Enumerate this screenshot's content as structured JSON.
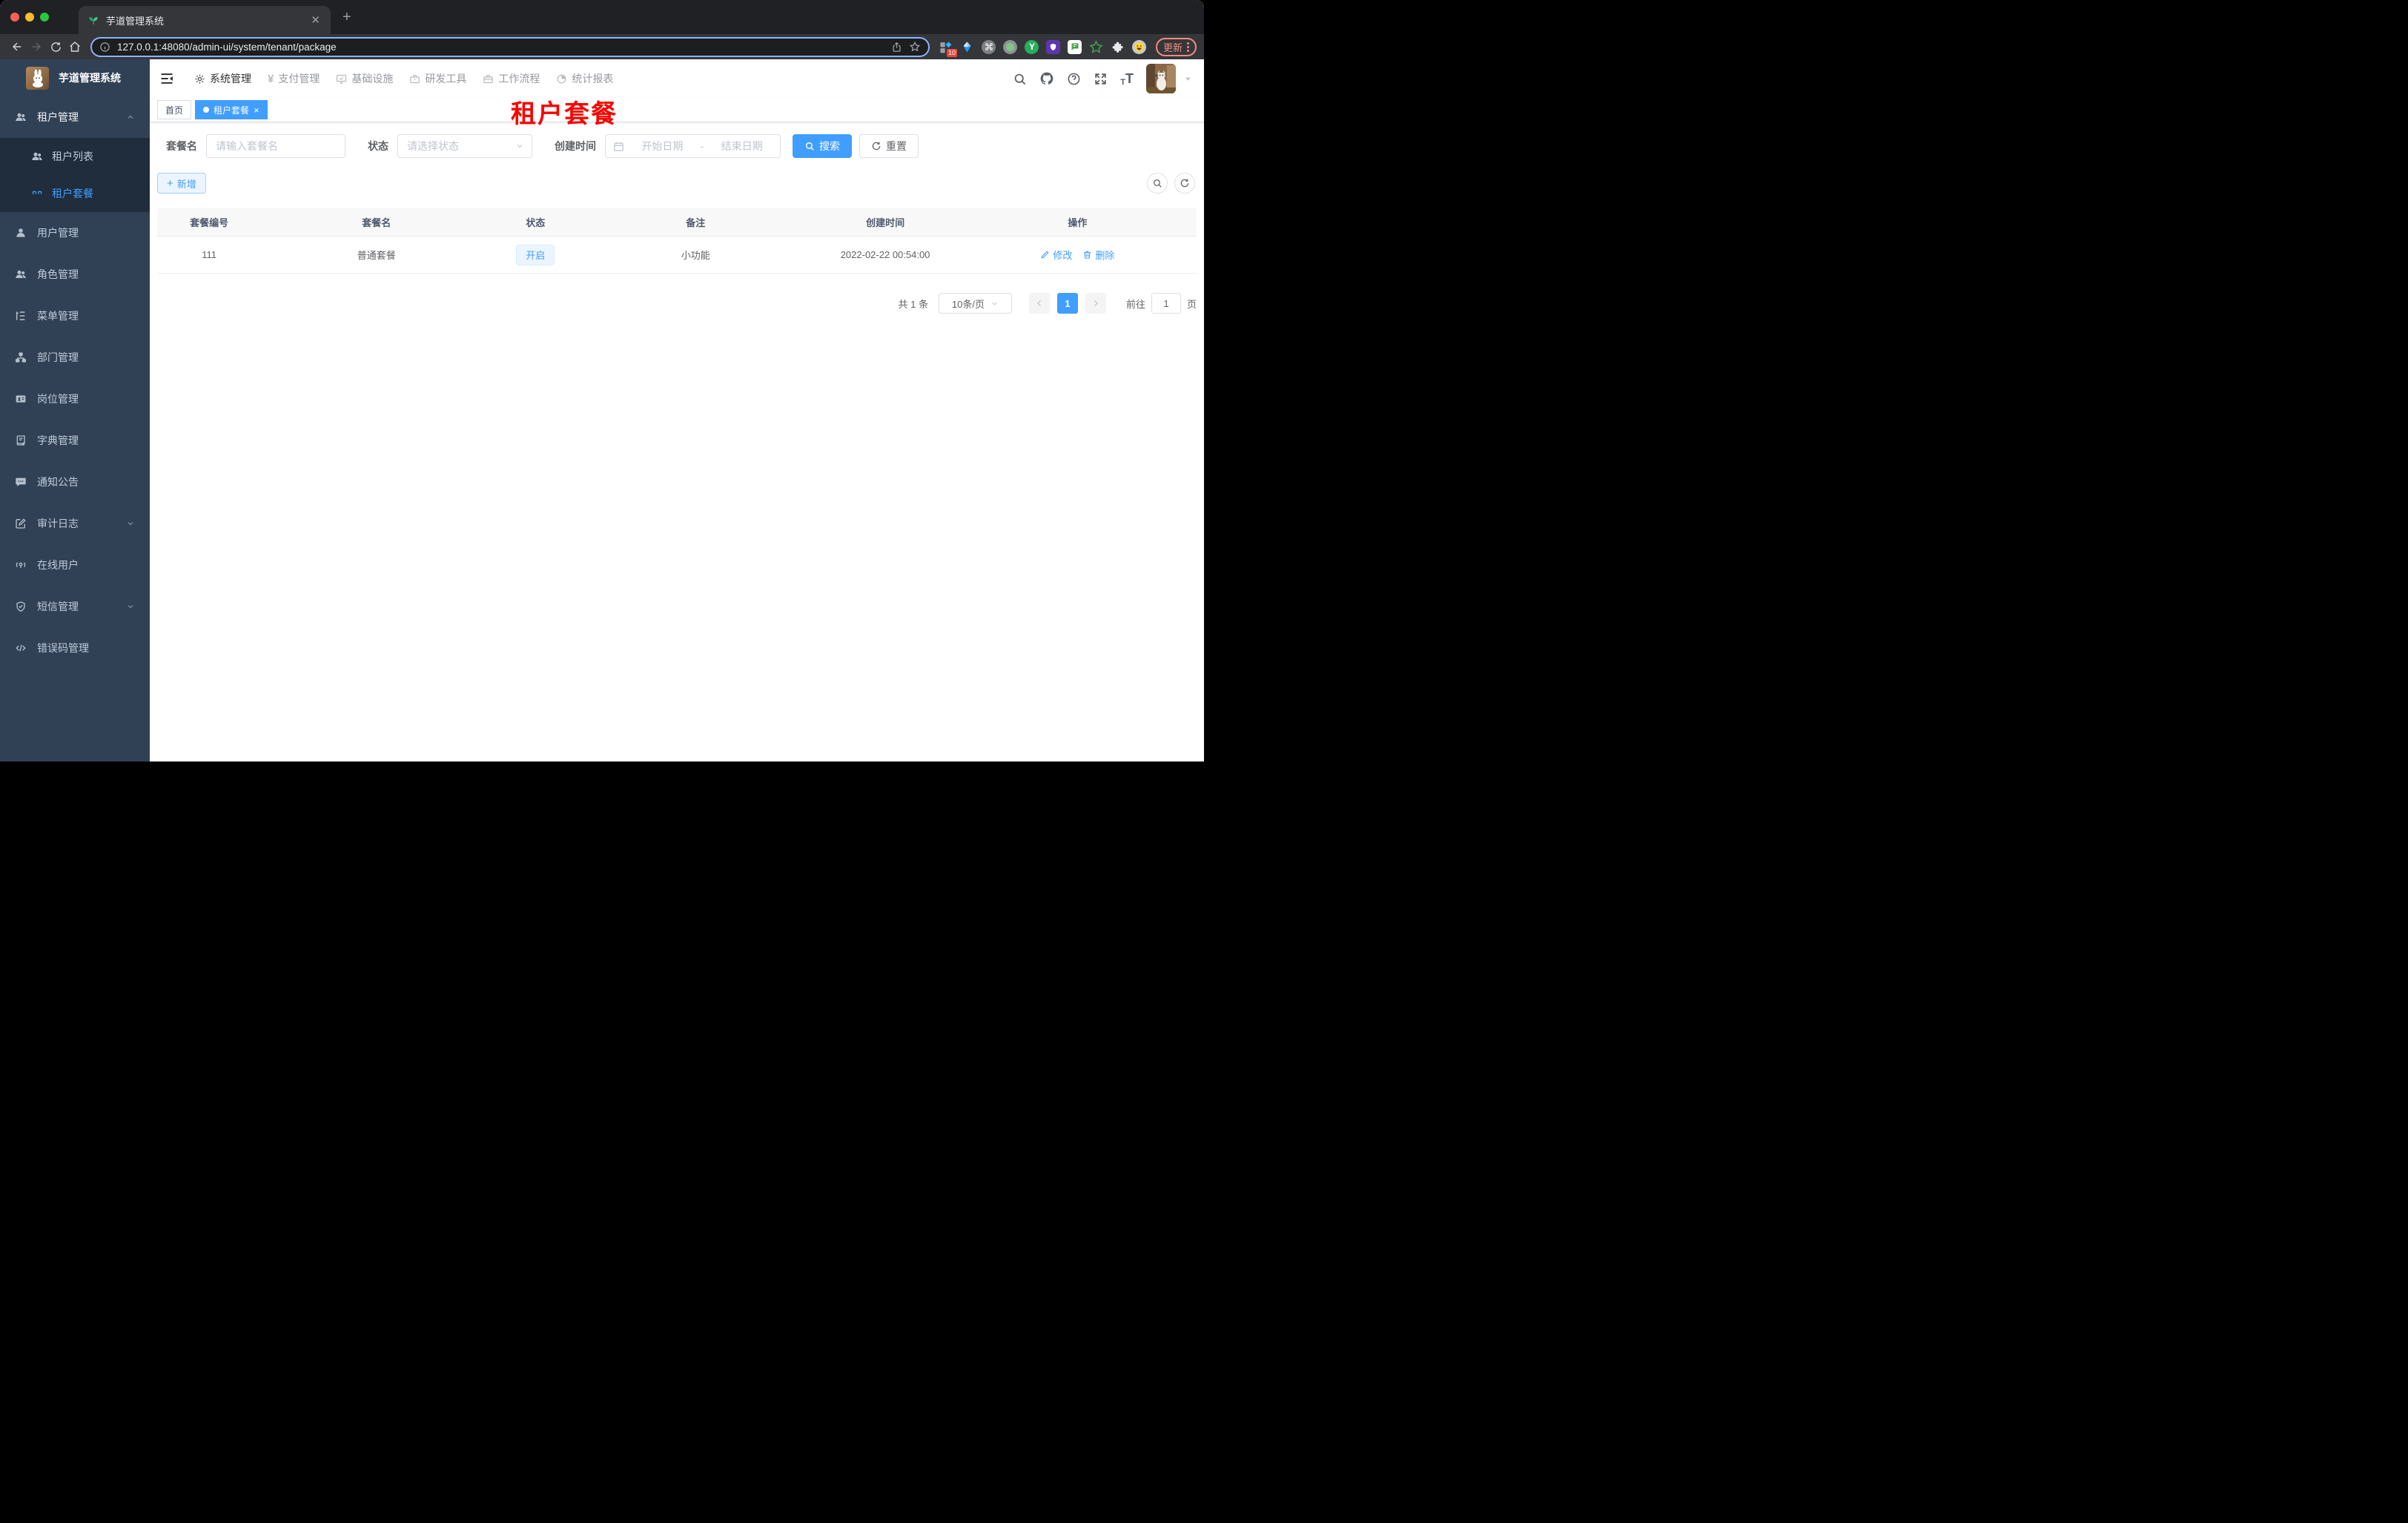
{
  "colors": {
    "accent": "#409eff",
    "sidebar_bg": "#304156",
    "submenu_bg": "#1f2d3d",
    "annotation_red": "#f80400",
    "chrome_bg": "#202124",
    "update_pink": "#f28b82",
    "tag_blue_bg": "#ecf5ff"
  },
  "browser": {
    "tab_title": "芋道管理系统",
    "url": "127.0.0.1:48080/admin-ui/system/tenant/package",
    "update_label": "更新",
    "extension_badge": "10"
  },
  "sidebar": {
    "title": "芋道管理系统",
    "items": [
      {
        "label": "租户管理"
      },
      {
        "label": "租户列表"
      },
      {
        "label": "租户套餐"
      },
      {
        "label": "用户管理"
      },
      {
        "label": "角色管理"
      },
      {
        "label": "菜单管理"
      },
      {
        "label": "部门管理"
      },
      {
        "label": "岗位管理"
      },
      {
        "label": "字典管理"
      },
      {
        "label": "通知公告"
      },
      {
        "label": "审计日志"
      },
      {
        "label": "在线用户"
      },
      {
        "label": "短信管理"
      },
      {
        "label": "错误码管理"
      }
    ]
  },
  "header": {
    "nav": [
      {
        "label": "系统管理"
      },
      {
        "label": "支付管理"
      },
      {
        "label": "基础设施"
      },
      {
        "label": "研发工具"
      },
      {
        "label": "工作流程"
      },
      {
        "label": "统计报表"
      }
    ]
  },
  "tags": {
    "home": "首页",
    "active": "租户套餐"
  },
  "annotation": "租户套餐",
  "filters": {
    "name_label": "套餐名",
    "name_placeholder": "请输入套餐名",
    "status_label": "状态",
    "status_placeholder": "请选择状态",
    "date_label": "创建时间",
    "date_start": "开始日期",
    "date_sep": "-",
    "date_end": "结束日期",
    "search_label": "搜索",
    "reset_label": "重置"
  },
  "toolbar": {
    "add_label": "新增"
  },
  "table": {
    "headers": [
      "套餐编号",
      "套餐名",
      "状态",
      "备注",
      "创建时间",
      "操作"
    ],
    "rows": [
      {
        "id": "111",
        "name": "普通套餐",
        "status": "开启",
        "remark": "小功能",
        "created_at": "2022-02-22 00:54:00",
        "edit_label": "修改",
        "delete_label": "删除"
      }
    ]
  },
  "pagination": {
    "total": "共 1 条",
    "page_size": "10条/页",
    "current": "1",
    "goto_label": "前往",
    "goto_value": "1",
    "unit_label": "页"
  }
}
